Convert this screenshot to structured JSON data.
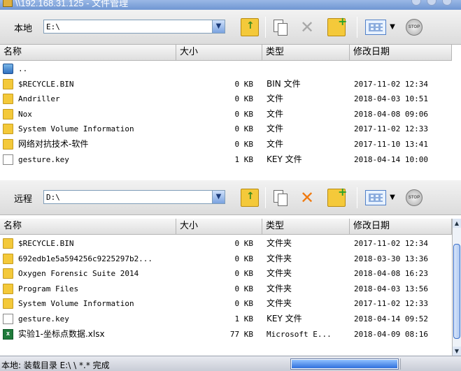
{
  "window": {
    "title": "\\\\192.168.31.125 - 文件管理"
  },
  "local": {
    "label": "本地",
    "path": "E:\\",
    "columns": [
      "名称",
      "大小",
      "类型",
      "修改日期"
    ],
    "rows": [
      {
        "icon": "up",
        "name": "..",
        "size": "",
        "type": "",
        "date": ""
      },
      {
        "icon": "folder",
        "name": "$RECYCLE.BIN",
        "size": "0 KB",
        "type": "BIN 文件",
        "date": "2017-11-02 12:34"
      },
      {
        "icon": "folder",
        "name": "Andriller",
        "size": "0 KB",
        "type": "文件",
        "date": "2018-04-03 10:51"
      },
      {
        "icon": "folder",
        "name": "Nox",
        "size": "0 KB",
        "type": "文件",
        "date": "2018-04-08 09:06"
      },
      {
        "icon": "folder",
        "name": "System Volume Information",
        "size": "0 KB",
        "type": "文件",
        "date": "2017-11-02 12:33"
      },
      {
        "icon": "folder",
        "name": "网络对抗技术-软件",
        "size": "0 KB",
        "type": "文件",
        "date": "2017-11-10 13:41"
      },
      {
        "icon": "file",
        "name": "gesture.key",
        "size": "1 KB",
        "type": "KEY 文件",
        "date": "2018-04-14 10:00"
      }
    ]
  },
  "remote": {
    "label": "远程",
    "path": "D:\\",
    "columns": [
      "名称",
      "大小",
      "类型",
      "修改日期"
    ],
    "rows": [
      {
        "icon": "folder",
        "name": "$RECYCLE.BIN",
        "size": "0 KB",
        "type": "文件夹",
        "date": "2017-11-02 12:34"
      },
      {
        "icon": "folder",
        "name": "692edb1e5a594256c9225297b2...",
        "size": "0 KB",
        "type": "文件夹",
        "date": "2018-03-30 13:36"
      },
      {
        "icon": "folder",
        "name": "Oxygen Forensic Suite 2014",
        "size": "0 KB",
        "type": "文件夹",
        "date": "2018-04-08 16:23"
      },
      {
        "icon": "folder",
        "name": "Program Files",
        "size": "0 KB",
        "type": "文件夹",
        "date": "2018-04-03 13:56"
      },
      {
        "icon": "folder",
        "name": "System Volume Information",
        "size": "0 KB",
        "type": "文件夹",
        "date": "2017-11-02 12:33"
      },
      {
        "icon": "file",
        "name": "gesture.key",
        "size": "1 KB",
        "type": "KEY 文件",
        "date": "2018-04-14 09:52"
      },
      {
        "icon": "xlsx",
        "name": "实验1-坐标点数据.xlsx",
        "size": "77 KB",
        "type": "Microsoft E...",
        "date": "2018-04-09 08:16"
      }
    ]
  },
  "toolbar_icons": {
    "up": "folder-up-icon",
    "copy": "copy-icon",
    "delete": "delete-icon",
    "new_folder": "new-folder-icon",
    "view": "view-mode-icon",
    "stop": "stop-icon",
    "stop_text": "STOP"
  },
  "status": {
    "text": "本地: 装载目录 E:\\ \\ *.* 完成",
    "progress": 1.0
  },
  "colors": {
    "accent": "#2f6fdc",
    "folder": "#f4c93a",
    "delete_active": "#f07a10"
  }
}
